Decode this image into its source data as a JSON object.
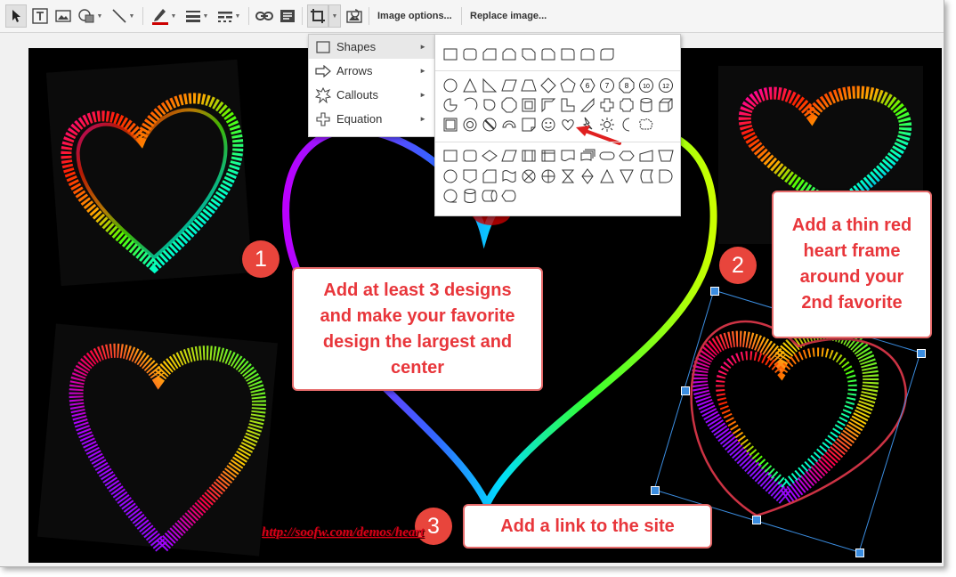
{
  "toolbar": {
    "image_options_label": "Image options...",
    "replace_image_label": "Replace image...",
    "icons": [
      "select-icon",
      "text-box-icon",
      "image-icon",
      "shape-icon",
      "line-icon",
      "line-color-icon",
      "line-weight-icon",
      "line-dash-icon",
      "link-icon",
      "comment-icon",
      "crop-icon",
      "mask-image-icon",
      "reset-image-icon"
    ],
    "line_color": "#cc0000"
  },
  "insert_menu": {
    "items": [
      {
        "label": "Shapes",
        "icon": "square-icon"
      },
      {
        "label": "Arrows",
        "icon": "arrow-icon"
      },
      {
        "label": "Callouts",
        "icon": "callout-burst-icon"
      },
      {
        "label": "Equation",
        "icon": "plus-icon"
      }
    ]
  },
  "shapes_panel": {
    "numbered_shapes": [
      "6",
      "7",
      "8",
      "10",
      "12"
    ]
  },
  "callouts": {
    "step1_number": "1",
    "step1_text": "Add at least 3 designs and make your favorite design the largest and center",
    "step2_number": "2",
    "step2_text": "Add a thin red heart frame around your 2nd favorite",
    "step3_number": "3",
    "step3_text": "Add a link to the site"
  },
  "slide": {
    "link_text": "http://soofw.com/demos/heart",
    "accent_red": "#e8363b",
    "selection_blue": "#3b8de0"
  }
}
